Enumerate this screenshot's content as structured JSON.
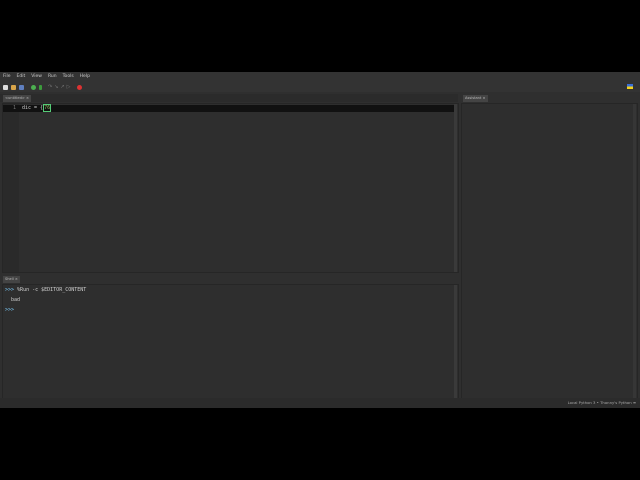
{
  "menu": [
    "File",
    "Edit",
    "View",
    "Run",
    "Tools",
    "Help"
  ],
  "toolbar": {
    "buttons": [
      "new-file-icon",
      "open-icon",
      "save-icon",
      "run-icon",
      "debug-icon",
      "step-over-icon",
      "step-into-icon",
      "step-out-icon",
      "resume-icon",
      "stop-icon"
    ]
  },
  "editor": {
    "tab_label": "<untitled> ×",
    "lines": [
      {
        "number": "1",
        "text": "dic = {"
      }
    ],
    "cursor_char": "76"
  },
  "assistant": {
    "tab_label": "Assistant ×"
  },
  "shell": {
    "tab_label": "Shell ×",
    "prompt": ">>>",
    "command": "%Run -c $EDITOR_CONTENT",
    "output": "bad",
    "prompt2": ">>>"
  },
  "status": {
    "text": "Local Python 3  •  Thonny's Python  ≡"
  },
  "colors": {
    "background": "#2f2f2f",
    "prompt": "#7fd0ff",
    "stop": "#d33",
    "run": "#4caf50"
  }
}
